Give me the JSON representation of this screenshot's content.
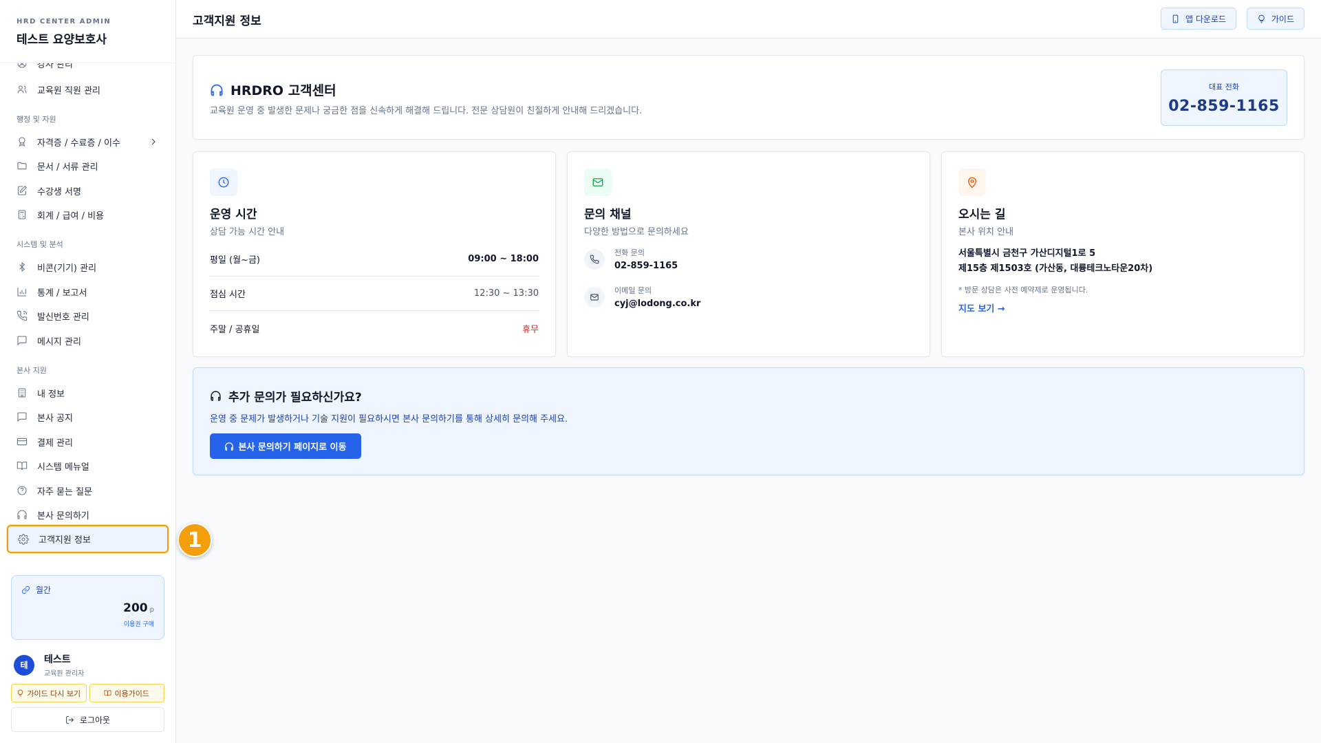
{
  "sidebar": {
    "brand_sub": "HRD CENTER ADMIN",
    "brand_title": "테스트 요양보호사",
    "items_top": [
      {
        "label": "강사 관리",
        "icon": "user-circle-icon"
      },
      {
        "label": "교육원 직원 관리",
        "icon": "users-icon"
      }
    ],
    "section_admin": "행정 및 자원",
    "items_admin": [
      {
        "label": "자격증 / 수료증 / 이수",
        "icon": "award-icon"
      },
      {
        "label": "문서 / 서류 관리",
        "icon": "folder-icon"
      },
      {
        "label": "수강생 서명",
        "icon": "signature-icon"
      },
      {
        "label": "회계 / 급여 / 비용",
        "icon": "calculator-icon"
      }
    ],
    "section_system": "시스템 및 분석",
    "items_system": [
      {
        "label": "비콘(기기) 관리",
        "icon": "bluetooth-icon"
      },
      {
        "label": "통계 / 보고서",
        "icon": "bar-chart-icon"
      },
      {
        "label": "발신번호 관리",
        "icon": "phone-call-icon"
      },
      {
        "label": "메시지 관리",
        "icon": "message-icon"
      }
    ],
    "section_hq": "본사 지원",
    "items_hq": [
      {
        "label": "내 정보",
        "icon": "building-icon"
      },
      {
        "label": "본사 공지",
        "icon": "message-square-icon"
      },
      {
        "label": "결제 관리",
        "icon": "credit-card-icon"
      },
      {
        "label": "시스템 메뉴얼",
        "icon": "book-icon"
      },
      {
        "label": "자주 묻는 질문",
        "icon": "help-circle-icon"
      },
      {
        "label": "본사 문의하기",
        "icon": "headphones-icon"
      },
      {
        "label": "고객지원 정보",
        "icon": "gear-icon"
      }
    ],
    "step_badge": "1",
    "plan": {
      "label": "월간",
      "points": "200",
      "unit": "p",
      "buy": "이용권 구매"
    },
    "user": {
      "avatar": "테",
      "name": "테스트",
      "role": "교육원 관리자"
    },
    "guide_again": "가이드 다시 보기",
    "usage_guide": "이용가이드",
    "logout": "로그아웃"
  },
  "header": {
    "title": "고객지원 정보",
    "app_download": "앱 다운로드",
    "guide": "가이드"
  },
  "hero": {
    "title": "HRDRO 고객센터",
    "description": "교육원 운영 중 발생한 문제나 궁금한 점을 신속하게 해결해 드립니다. 전문 상담원이 친절하게 안내해 드리겠습니다.",
    "phone_label": "대표 전화",
    "phone_number": "02-859-1165"
  },
  "hours": {
    "title": "운영 시간",
    "subtitle": "상담 가능 시간 안내",
    "rows": [
      {
        "label": "평일 (월~금)",
        "value": "09:00 ~ 18:00"
      },
      {
        "label": "점심 시간",
        "value": "12:30 ~ 13:30"
      },
      {
        "label": "주말 / 공휴일",
        "value": "휴무"
      }
    ]
  },
  "channels": {
    "title": "문의 채널",
    "subtitle": "다양한 방법으로 문의하세요",
    "phone_label": "전화 문의",
    "phone_value": "02-859-1165",
    "email_label": "이메일 문의",
    "email_value": "cyj@lodong.co.kr"
  },
  "location": {
    "title": "오시는 길",
    "subtitle": "본사 위치 안내",
    "address_line1": "서울특별시 금천구 가산디지털1로 5",
    "address_line2": "제15층 제1503호 (가산동, 대륭테크노타운20차)",
    "note": "* 방문 상담은 사전 예약제로 운영됩니다.",
    "map_link": "지도 보기 →"
  },
  "extra": {
    "title": "추가 문의가 필요하신가요?",
    "description": "운영 중 문제가 발생하거나 기술 지원이 필요하시면 본사 문의하기를 통해 상세히 문의해 주세요.",
    "button": "본사 문의하기 페이지로 이동"
  },
  "colors": {
    "accent": "#2563eb",
    "highlight": "#f59e0b",
    "danger": "#dc2626",
    "mail_green": "#16a34a",
    "pin_orange": "#ea580c"
  }
}
